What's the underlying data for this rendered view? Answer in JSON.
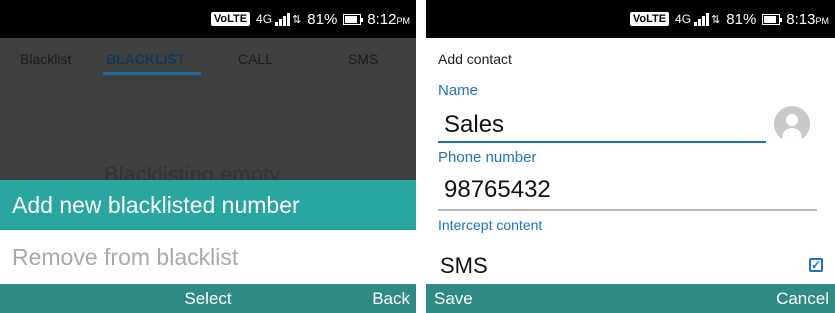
{
  "left_screen": {
    "status": {
      "volte": "VoLTE",
      "network": "4G",
      "battery": "81%",
      "time": "8:12",
      "ampm": "PM"
    },
    "tabs": [
      {
        "label": "Blacklist"
      },
      {
        "label": "BLACKLIST"
      },
      {
        "label": "CALL"
      },
      {
        "label": "SMS"
      }
    ],
    "empty_text": "Blacklisting empty",
    "menu": {
      "item1": "Add new blacklisted number",
      "item2": "Remove from blacklist"
    },
    "softkeys": {
      "center": "Select",
      "right": "Back"
    }
  },
  "right_screen": {
    "status": {
      "volte": "VoLTE",
      "network": "4G",
      "battery": "81%",
      "time": "8:13",
      "ampm": "PM"
    },
    "title": "Add contact",
    "name_label": "Name",
    "name_value": "Sales",
    "phone_label": "Phone number",
    "phone_value": "98765432",
    "intercept_label": "Intercept content",
    "intercept_value": "SMS",
    "intercept_checked": true,
    "softkeys": {
      "left": "Save",
      "right": "Cancel"
    }
  },
  "colors": {
    "accent": "#1e73be",
    "menu_highlight": "#2aa6a0",
    "softbar": "#2f8a84"
  }
}
